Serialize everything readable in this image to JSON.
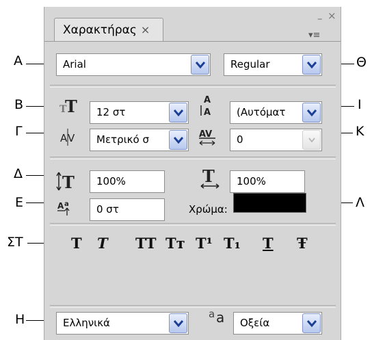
{
  "panel": {
    "tab_label": "Χαρακτήρας",
    "close_glyph": "×",
    "minimize_glyph": "–",
    "menu_glyph": "▾≡"
  },
  "callouts": {
    "A": "A",
    "B": "B",
    "G": "Γ",
    "D": "Δ",
    "E": "E",
    "ST": "ΣΤ",
    "H": "H",
    "TH": "Θ",
    "I": "I",
    "K": "K",
    "L": "Λ"
  },
  "font": {
    "family": "Arial",
    "style": "Regular"
  },
  "size": {
    "font_size": "12 στ",
    "leading": "(Αυτόματ"
  },
  "spacing": {
    "kerning": "Μετρικό σ",
    "tracking": "0"
  },
  "scale": {
    "vertical": "100%",
    "horizontal": "100%"
  },
  "baseline": {
    "shift": "0 στ",
    "color_label": "Χρώμα:",
    "color_value": "#000000"
  },
  "style_buttons": [
    {
      "name": "faux-bold",
      "glyph": "T"
    },
    {
      "name": "faux-italic",
      "glyph": "T"
    },
    {
      "name": "all-caps",
      "glyph": "TT"
    },
    {
      "name": "small-caps",
      "glyph": "Tт"
    },
    {
      "name": "superscript",
      "glyph": "T¹"
    },
    {
      "name": "subscript",
      "glyph": "T₁"
    },
    {
      "name": "underline",
      "glyph": "T"
    },
    {
      "name": "strikethrough",
      "glyph": "Ŧ"
    }
  ],
  "language": {
    "value": "Ελληνικά",
    "aa_label": "a",
    "anti_alias": "Οξεία"
  }
}
